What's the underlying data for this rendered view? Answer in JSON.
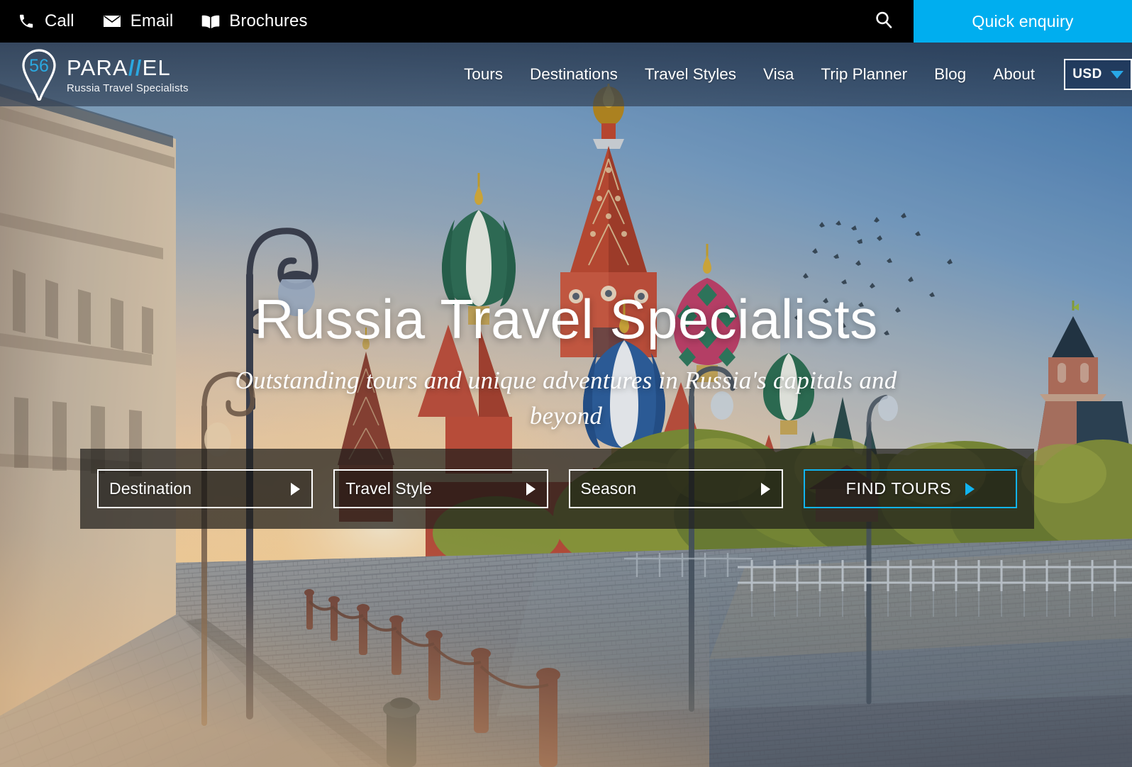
{
  "topbar": {
    "items": [
      {
        "label": "Call",
        "icon": "phone-icon"
      },
      {
        "label": "Email",
        "icon": "envelope-icon"
      },
      {
        "label": "Brochures",
        "icon": "book-icon"
      }
    ],
    "search_icon": "search-icon",
    "enquiry_label": "Quick enquiry",
    "enquiry_color": "#00AEEF"
  },
  "logo": {
    "badge_number": "56",
    "name_part1": "PARA",
    "name_slash": "//",
    "name_part2": "EL",
    "tagline": "Russia Travel Specialists",
    "accent_color": "#2BA8E0"
  },
  "nav": {
    "links": [
      {
        "label": "Tours"
      },
      {
        "label": "Destinations"
      },
      {
        "label": "Travel Styles"
      },
      {
        "label": "Visa"
      },
      {
        "label": "Trip Planner"
      },
      {
        "label": "Blog"
      },
      {
        "label": "About"
      }
    ],
    "currency": {
      "value": "USD",
      "chevron_icon": "chevron-down-icon",
      "chevron_color": "#28A8E8"
    }
  },
  "hero": {
    "title": "Russia Travel Specialists",
    "subtitle": "Outstanding tours and unique adventures in Russia's capitals and beyond"
  },
  "search_form": {
    "destination": {
      "label": "Destination",
      "arrow_icon": "triangle-right-icon"
    },
    "travel_style": {
      "label": "Travel Style",
      "arrow_icon": "triangle-right-icon"
    },
    "season": {
      "label": "Season",
      "arrow_icon": "triangle-right-icon"
    },
    "submit": {
      "label": "FIND TOURS",
      "arrow_icon": "triangle-right-icon",
      "accent_color": "#11B4F0"
    }
  }
}
